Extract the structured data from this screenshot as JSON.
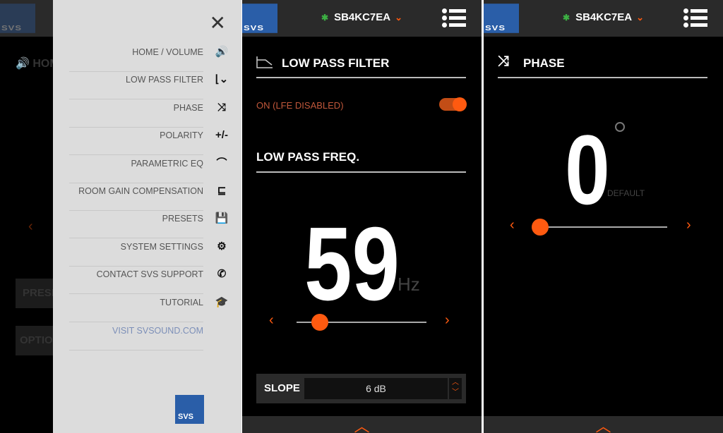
{
  "header": {
    "logo": "SVS",
    "device_name": "SB4KC7EA",
    "bluetooth_icon": "bluetooth-icon",
    "dropdown_icon": "chevron-down-icon",
    "menu_icon": "list-menu-icon"
  },
  "panel1": {
    "background": {
      "heading": "HOME / VOLUME",
      "presets_label": "PRESETS",
      "options_label": "OPTIONS"
    },
    "drawer": {
      "items": [
        {
          "label": "HOME / VOLUME",
          "icon": "volume-icon"
        },
        {
          "label": "LOW PASS FILTER",
          "icon": "low-pass-filter-icon"
        },
        {
          "label": "PHASE",
          "icon": "phase-icon"
        },
        {
          "label": "POLARITY",
          "icon": "+/-"
        },
        {
          "label": "PARAMETRIC EQ",
          "icon": "parametric-eq-icon"
        },
        {
          "label": "ROOM GAIN COMPENSATION",
          "icon": "room-gain-icon"
        },
        {
          "label": "PRESETS",
          "icon": "save-icon"
        },
        {
          "label": "SYSTEM SETTINGS",
          "icon": "gear-icon"
        },
        {
          "label": "CONTACT SVS SUPPORT",
          "icon": "phone-icon"
        },
        {
          "label": "TUTORIAL",
          "icon": "graduation-cap-icon"
        }
      ],
      "link": "VISIT SVSOUND.COM",
      "logo": "SVS"
    }
  },
  "panel2": {
    "title": "LOW PASS FILTER",
    "toggle_label": "ON (LFE DISABLED)",
    "toggle_on": true,
    "freq_heading": "LOW PASS FREQ.",
    "value": "59",
    "unit": "Hz",
    "slider_fraction": 0.18,
    "slope_label": "SLOPE",
    "slope_value": "6 dB"
  },
  "panel3": {
    "title": "PHASE",
    "value": "0",
    "degree_symbol": "°",
    "default_label": "DEFAULT",
    "slider_fraction": 0.0
  },
  "colors": {
    "accent": "#ff5a10",
    "brand": "#2a5ea8",
    "bluetooth": "#3cb043"
  }
}
